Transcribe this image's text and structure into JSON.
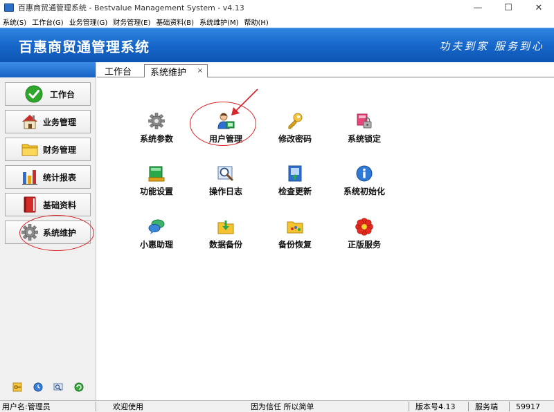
{
  "window": {
    "title": "百惠商贸通管理系统 - Bestvalue Management System - v4.13",
    "minimize": "—",
    "maximize": "☐",
    "close": "✕"
  },
  "menubar": [
    "系统(S)",
    "工作台(G)",
    "业务管理(G)",
    "财务管理(E)",
    "基础资料(B)",
    "系统维护(M)",
    "帮助(H)"
  ],
  "banner": {
    "title": "百惠商贸通管理系统",
    "slogan": "功夫到家 服务到心"
  },
  "sidebar": {
    "items": [
      {
        "label": "工作台",
        "icon": "check-icon"
      },
      {
        "label": "业务管理",
        "icon": "house-icon"
      },
      {
        "label": "财务管理",
        "icon": "folder-icon"
      },
      {
        "label": "统计报表",
        "icon": "bar-chart-icon"
      },
      {
        "label": "基础资料",
        "icon": "book-icon"
      },
      {
        "label": "系统维护",
        "icon": "gear-icon"
      }
    ],
    "bottom_icons": [
      "key-icon",
      "clock-icon",
      "search-icon",
      "refresh-icon"
    ]
  },
  "tabs": {
    "workbench": "工作台",
    "active": "系统维护",
    "close": "×"
  },
  "tiles": [
    {
      "label": "系统参数",
      "icon": "gear-icon"
    },
    {
      "label": "用户管理",
      "icon": "user-icon"
    },
    {
      "label": "修改密码",
      "icon": "key-icon"
    },
    {
      "label": "系统锁定",
      "icon": "lock-icon"
    },
    {
      "label": "功能设置",
      "icon": "module-icon"
    },
    {
      "label": "操作日志",
      "icon": "magnifier-icon"
    },
    {
      "label": "检查更新",
      "icon": "update-icon"
    },
    {
      "label": "系统初始化",
      "icon": "info-icon"
    },
    {
      "label": "小惠助理",
      "icon": "chat-icon"
    },
    {
      "label": "数据备份",
      "icon": "backup-icon"
    },
    {
      "label": "备份恢复",
      "icon": "restore-icon"
    },
    {
      "label": "正版服务",
      "icon": "flower-icon"
    }
  ],
  "statusbar": {
    "user": "用户名:管理员",
    "welcome": "欢迎使用",
    "motto": "因为信任 所以简单",
    "version": "版本号4.13",
    "server": "服务端",
    "port": "59917"
  },
  "colors": {
    "banner": "#1565c8",
    "annotation": "#d9262a"
  }
}
